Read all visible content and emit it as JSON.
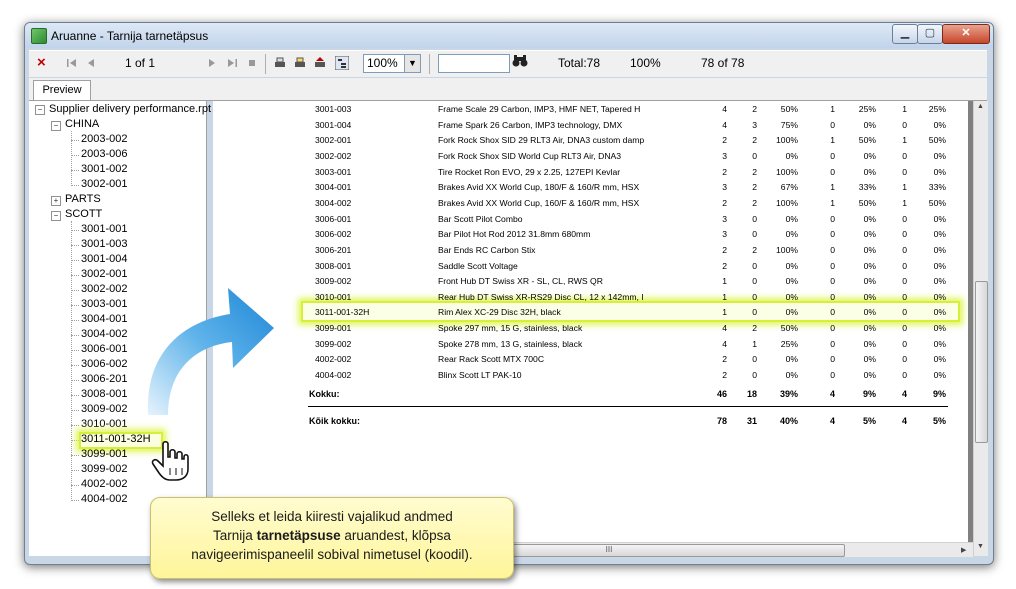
{
  "window": {
    "title": "Aruanne - Tarnija tarnetäpsus",
    "buttons": {
      "minimize": "▁",
      "maximize": "▢",
      "close": "✕"
    }
  },
  "toolbar": {
    "close_icon": "×",
    "page_info": "1 of 1",
    "zoom_value": "100%",
    "search_value": "",
    "total_label": "Total:78",
    "percent_label": "100%",
    "count_label": "78 of 78"
  },
  "tabs": [
    {
      "label": "Preview"
    }
  ],
  "tree": {
    "root": "Supplier delivery performance.rpt",
    "groups": [
      {
        "label": "CHINA",
        "expanded": true,
        "items": [
          "2003-002",
          "2003-006",
          "3001-002",
          "3002-001"
        ]
      },
      {
        "label": "PARTS",
        "expanded": false,
        "items": []
      },
      {
        "label": "SCOTT",
        "expanded": true,
        "items": [
          "3001-001",
          "3001-003",
          "3001-004",
          "3002-001",
          "3002-002",
          "3003-001",
          "3004-001",
          "3004-002",
          "3006-001",
          "3006-002",
          "3006-201",
          "3008-001",
          "3009-002",
          "3010-001",
          "3011-001-32H",
          "3099-001",
          "3099-002",
          "4002-002",
          "4004-002"
        ]
      }
    ],
    "selected": "3011-001-32H"
  },
  "report": {
    "rows": [
      {
        "code": "3001-003",
        "desc": "Frame Scale 29 Carbon, IMP3, HMF NET, Tapered H",
        "v": [
          "4",
          "2",
          "50%",
          "1",
          "25%",
          "1",
          "25%"
        ]
      },
      {
        "code": "3001-004",
        "desc": "Frame Spark 26 Carbon, IMP3 technology, DMX",
        "v": [
          "4",
          "3",
          "75%",
          "0",
          "0%",
          "0",
          "0%"
        ]
      },
      {
        "code": "3002-001",
        "desc": "Fork Rock Shox SID 29 RLT3 Air, DNA3 custom damp",
        "v": [
          "2",
          "2",
          "100%",
          "1",
          "50%",
          "1",
          "50%"
        ]
      },
      {
        "code": "3002-002",
        "desc": "Fork Rock Shox SID World Cup RLT3 Air, DNA3",
        "v": [
          "3",
          "0",
          "0%",
          "0",
          "0%",
          "0",
          "0%"
        ]
      },
      {
        "code": "3003-001",
        "desc": "Tire Rocket Ron EVO, 29 x 2.25, 127EPI Kevlar",
        "v": [
          "2",
          "2",
          "100%",
          "0",
          "0%",
          "0",
          "0%"
        ]
      },
      {
        "code": "3004-001",
        "desc": "Brakes Avid XX World Cup, 180/F & 160/R mm, HSX",
        "v": [
          "3",
          "2",
          "67%",
          "1",
          "33%",
          "1",
          "33%"
        ]
      },
      {
        "code": "3004-002",
        "desc": "Brakes Avid XX World Cup, 160/F & 160/R mm, HSX",
        "v": [
          "2",
          "2",
          "100%",
          "1",
          "50%",
          "1",
          "50%"
        ]
      },
      {
        "code": "3006-001",
        "desc": "Bar Scott Pilot Combo",
        "v": [
          "3",
          "0",
          "0%",
          "0",
          "0%",
          "0",
          "0%"
        ]
      },
      {
        "code": "3006-002",
        "desc": "Bar Pilot Hot Rod 2012 31.8mm 680mm",
        "v": [
          "3",
          "0",
          "0%",
          "0",
          "0%",
          "0",
          "0%"
        ]
      },
      {
        "code": "3006-201",
        "desc": "Bar Ends RC Carbon Stix",
        "v": [
          "2",
          "2",
          "100%",
          "0",
          "0%",
          "0",
          "0%"
        ]
      },
      {
        "code": "3008-001",
        "desc": "Saddle Scott Voltage",
        "v": [
          "2",
          "0",
          "0%",
          "0",
          "0%",
          "0",
          "0%"
        ]
      },
      {
        "code": "3009-002",
        "desc": "Front Hub DT Swiss XR - SL, CL, RWS QR",
        "v": [
          "1",
          "0",
          "0%",
          "0",
          "0%",
          "0",
          "0%"
        ]
      },
      {
        "code": "3010-001",
        "desc": "Rear Hub DT Swiss XR-RS29 Disc CL, 12 x 142mm, I",
        "v": [
          "1",
          "0",
          "0%",
          "0",
          "0%",
          "0",
          "0%"
        ]
      },
      {
        "code": "3011-001-32H",
        "desc": "Rim Alex XC-29 Disc 32H, black",
        "v": [
          "1",
          "0",
          "0%",
          "0",
          "0%",
          "0",
          "0%"
        ]
      },
      {
        "code": "3099-001",
        "desc": "Spoke 297 mm, 15 G, stainless, black",
        "v": [
          "4",
          "2",
          "50%",
          "0",
          "0%",
          "0",
          "0%"
        ]
      },
      {
        "code": "3099-002",
        "desc": "Spoke 278 mm, 13 G, stainless, black",
        "v": [
          "4",
          "1",
          "25%",
          "0",
          "0%",
          "0",
          "0%"
        ]
      },
      {
        "code": "4002-002",
        "desc": "Rear Rack Scott MTX 700C",
        "v": [
          "2",
          "0",
          "0%",
          "0",
          "0%",
          "0",
          "0%"
        ]
      },
      {
        "code": "4004-002",
        "desc": "Blinx Scott LT PAK-10",
        "v": [
          "2",
          "0",
          "0%",
          "0",
          "0%",
          "0",
          "0%"
        ]
      }
    ],
    "subtotal": {
      "label": "Kokku:",
      "v": [
        "46",
        "18",
        "39%",
        "4",
        "9%",
        "4",
        "9%"
      ]
    },
    "grandtotal": {
      "label": "Kõik kokku:",
      "v": [
        "78",
        "31",
        "40%",
        "4",
        "5%",
        "4",
        "5%"
      ]
    },
    "hscroll_label": "III"
  },
  "tooltip": {
    "line1": "Selleks et leida kiiresti vajalikud andmed",
    "line2_pre": "Tarnija ",
    "line2_bold": "tarnetäpsuse",
    "line2_post": " aruandest, klõpsa",
    "line3": "navigeerimispaneelil sobival nimetusel (koodil)."
  },
  "colors": {
    "highlight": "#d6f03a",
    "tooltip_bg": "#fff59a",
    "arrow": "#2b9be0",
    "close_btn": "#c6462a"
  },
  "icons": [
    "close-icon",
    "first-page-icon",
    "prev-page-icon",
    "next-page-icon",
    "last-page-icon",
    "stop-icon",
    "print-icon",
    "print-setup-icon",
    "export-icon",
    "group-tree-icon",
    "binoculars-icon",
    "hand-cursor-icon",
    "curved-arrow-icon"
  ]
}
